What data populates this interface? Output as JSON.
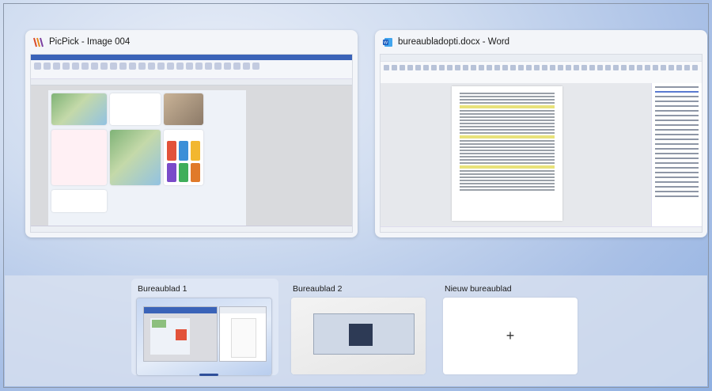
{
  "windows": [
    {
      "title": "PicPick - Image 004",
      "icon": "picpick-logo-icon",
      "accent": "#3a63b8"
    },
    {
      "title": "bureaubladopti.docx - Word",
      "icon": "word-icon",
      "accent": "#1f5bbf"
    }
  ],
  "desktops": [
    {
      "label": "Bureaublad 1",
      "active": true
    },
    {
      "label": "Bureaublad 2",
      "active": false
    },
    {
      "label": "Nieuw bureaublad",
      "action": "+"
    }
  ]
}
